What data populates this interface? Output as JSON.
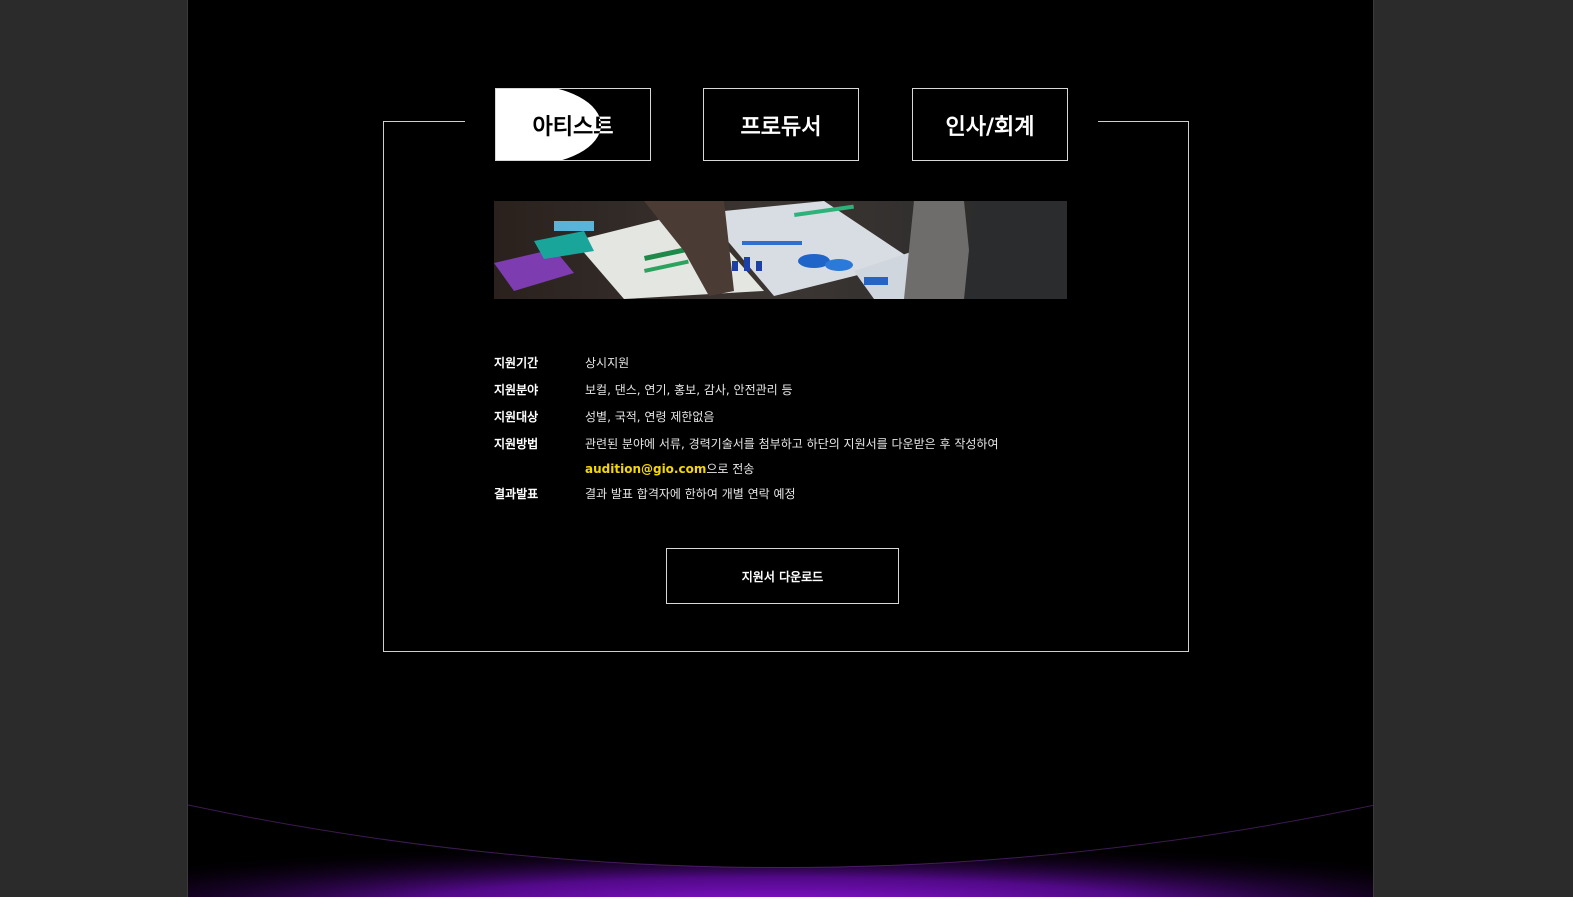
{
  "tabs": [
    {
      "label": "아티스트"
    },
    {
      "label": "프로듀서"
    },
    {
      "label": "인사/회계"
    }
  ],
  "info": {
    "period_key": "지원기간",
    "period_val": "상시지원",
    "field_key": "지원분야",
    "field_val": "보컬, 댄스, 연기, 홍보, 감사, 안전관리 등",
    "target_key": "지원대상",
    "target_val": "성별, 국적, 연령 제한없음",
    "method_key": "지원방법",
    "method_val": "관련된 분야에 서류, 경력기술서를 첨부하고 하단의 지원서를 다운받은 후 작성하여",
    "method_email": "audition@gio.com",
    "method_suffix": "으로 전송",
    "result_key": "결과발표",
    "result_val": "결과 발표 합격자에 한하여 개별 연락 예정"
  },
  "download_label": "지원서 다운로드",
  "colors": {
    "accent": "#f5d800",
    "glow": "#8a12d6",
    "background": "#000000"
  }
}
